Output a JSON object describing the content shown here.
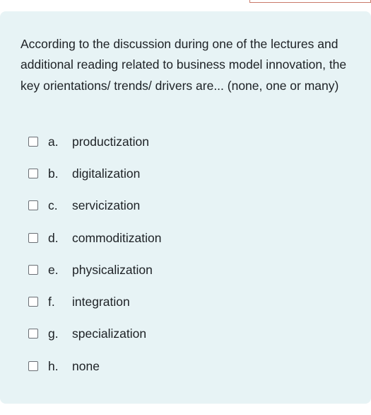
{
  "question": {
    "text": "According to the discussion during one of the lectures and additional reading related to business model innovation, the key orientations/ trends/ drivers are... (none, one or many)"
  },
  "answers": [
    {
      "letter": "a.",
      "label": "productization",
      "checked": false
    },
    {
      "letter": "b.",
      "label": "digitalization",
      "checked": false
    },
    {
      "letter": "c.",
      "label": "servicization",
      "checked": false
    },
    {
      "letter": "d.",
      "label": "commoditization",
      "checked": false
    },
    {
      "letter": "e.",
      "label": "physicalization",
      "checked": false
    },
    {
      "letter": "f.",
      "label": "integration",
      "checked": false
    },
    {
      "letter": "g.",
      "label": "specialization",
      "checked": false
    },
    {
      "letter": "h.",
      "label": "none",
      "checked": false
    }
  ]
}
